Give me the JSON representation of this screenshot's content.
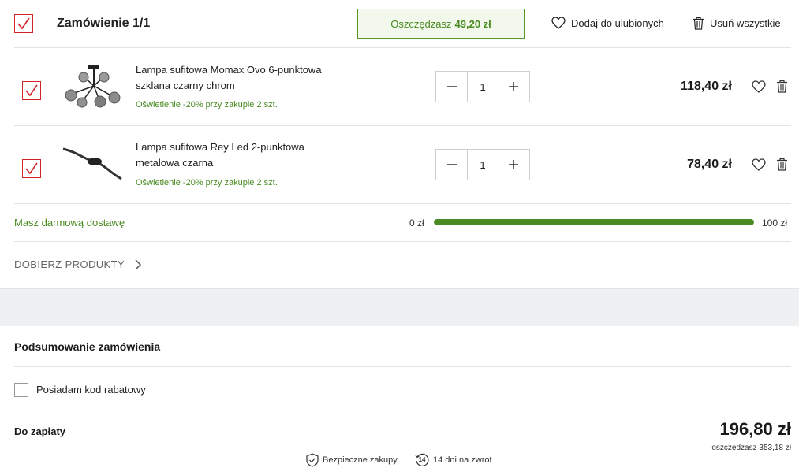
{
  "order": {
    "title": "Zamówienie 1/1",
    "savings_prefix": "Oszczędzasz",
    "savings_amount": "49,20 zł",
    "add_favorites_label": "Dodaj do ulubionych",
    "remove_all_label": "Usuń wszystkie"
  },
  "products": [
    {
      "name_line1": "Lampa sufitowa Momax Ovo 6-punktowa",
      "name_line2": "szklana czarny chrom",
      "promo": "Oświetlenie -20% przy zakupie 2 szt.",
      "quantity": "1",
      "price": "118,40 zł",
      "image_icon": "ceiling-lamp-globes-icon"
    },
    {
      "name_line1": "Lampa sufitowa Rey Led 2-punktowa",
      "name_line2": "metalowa czarna",
      "promo": "Oświetlenie -20% przy zakupie 2 szt.",
      "quantity": "1",
      "price": "78,40 zł",
      "image_icon": "ceiling-lamp-led-bar-icon"
    }
  ],
  "delivery": {
    "label": "Masz darmową dostawę",
    "min_label": "0 zł",
    "max_label": "100 zł",
    "progress_fraction": 1.0
  },
  "pick_products_label": "DOBIERZ PRODUKTY",
  "summary": {
    "title": "Podsumowanie zamówienia",
    "coupon_label": "Posiadam kod rabatowy",
    "total_label": "Do zapłaty",
    "total_price": "196,80 zł",
    "total_savings": "oszczędzasz 353,18 zł",
    "secure_label": "Bezpieczne zakupy",
    "return_badge": "14",
    "return_label": "14 dni na zwrot"
  },
  "colors": {
    "accent_red": "#d4242a",
    "accent_green": "#4a8a22"
  }
}
